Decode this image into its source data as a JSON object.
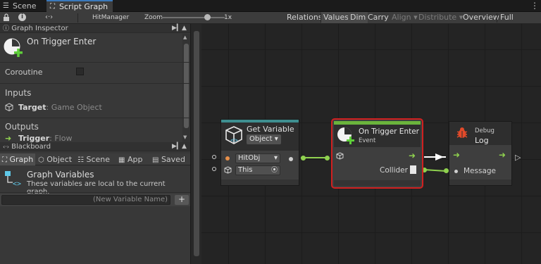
{
  "tabs": [
    {
      "label": "Scene"
    },
    {
      "label": "Script Graph"
    }
  ],
  "toolbar": {
    "graph_name": "HitManager",
    "zoom_label": "Zoom",
    "zoom_value": "1x",
    "buttons": {
      "relations": "Relations",
      "values": "Values",
      "dim": "Dim",
      "carry": "Carry",
      "align": "Align",
      "distribute": "Distribute",
      "overview": "Overview",
      "full_screen": "Full Screen"
    },
    "zoom_level": 0.72
  },
  "inspector": {
    "header": "Graph Inspector",
    "title": "On Trigger Enter",
    "coroutine_label": "Coroutine",
    "inputs_label": "Inputs",
    "target_name": "Target",
    "target_type": ": Game Object",
    "outputs_label": "Outputs",
    "trigger_name": "Trigger",
    "trigger_type": ": Flow"
  },
  "blackboard": {
    "header": "Blackboard",
    "tabs": [
      "Graph",
      "Object",
      "Scene",
      "App",
      "Saved"
    ],
    "section_title": "Graph Variables",
    "section_desc": "These variables are local to the current graph.",
    "new_var_placeholder": "(New Variable Name)",
    "add_label": "+"
  },
  "nodes": {
    "get_variable": {
      "title": "Get Variable",
      "kind": "Object",
      "name_value": "HitObj",
      "target_value": "This"
    },
    "trigger": {
      "title": "On Trigger Enter",
      "subtitle": "Event",
      "output": "Collider"
    },
    "debug": {
      "category": "Debug",
      "title": "Log",
      "input": "Message"
    }
  },
  "colors": {
    "accent_blue": "#3a79bb",
    "flow_green": "#8fd14f",
    "selection_red": "#d12020",
    "event_bar": "#6ab43c",
    "teal_bar": "#3e8f90"
  }
}
